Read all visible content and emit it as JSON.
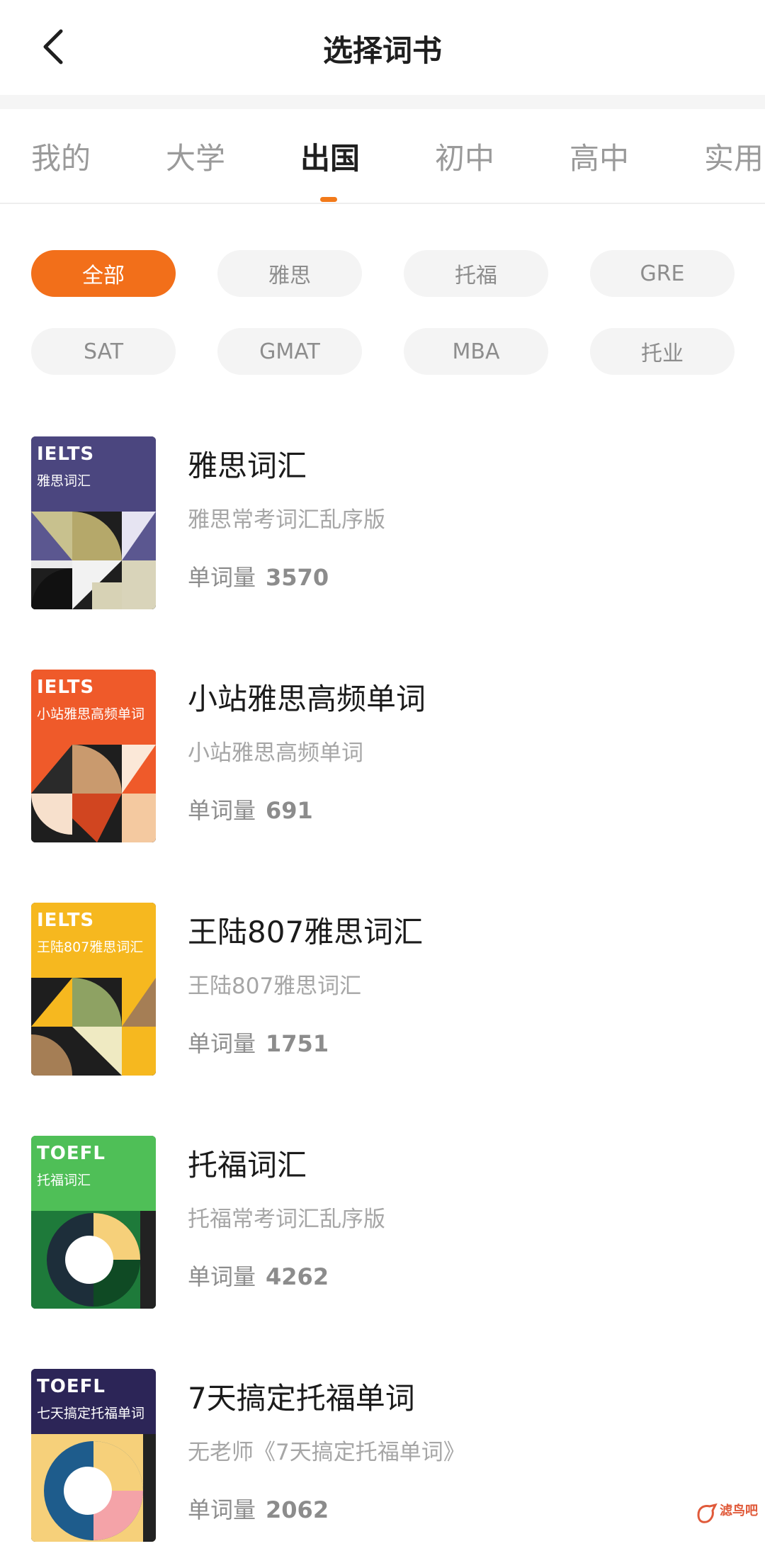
{
  "header": {
    "title": "选择词书"
  },
  "tabs": [
    {
      "label": "我的",
      "active": false
    },
    {
      "label": "大学",
      "active": false
    },
    {
      "label": "出国",
      "active": true
    },
    {
      "label": "初中",
      "active": false
    },
    {
      "label": "高中",
      "active": false
    },
    {
      "label": "实用",
      "active": false
    }
  ],
  "accent_color": "#f26f1a",
  "filters": [
    {
      "label": "全部",
      "active": true
    },
    {
      "label": "雅思",
      "active": false
    },
    {
      "label": "托福",
      "active": false
    },
    {
      "label": "GRE",
      "active": false
    },
    {
      "label": "SAT",
      "active": false
    },
    {
      "label": "GMAT",
      "active": false
    },
    {
      "label": "MBA",
      "active": false
    },
    {
      "label": "托业",
      "active": false
    }
  ],
  "count_label": "单词量",
  "books": [
    {
      "code": "IELTS",
      "cover_name": "雅思词汇",
      "title": "雅思词汇",
      "desc": "雅思常考词汇乱序版",
      "count": "3570",
      "cover_color": "#4b467f"
    },
    {
      "code": "IELTS",
      "cover_name": "小站雅思高频单词",
      "title": "小站雅思高频单词",
      "desc": "小站雅思高频单词",
      "count": "691",
      "cover_color": "#ef5a2a"
    },
    {
      "code": "IELTS",
      "cover_name": "王陆807雅思词汇",
      "title": "王陆807雅思词汇",
      "desc": "王陆807雅思词汇",
      "count": "1751",
      "cover_color": "#f6b81f"
    },
    {
      "code": "TOEFL",
      "cover_name": "托福词汇",
      "title": "托福词汇",
      "desc": "托福常考词汇乱序版",
      "count": "4262",
      "cover_color": "#4fbf57"
    },
    {
      "code": "TOEFL",
      "cover_name": "七天搞定托福单词",
      "title": "7天搞定托福单词",
      "desc": "无老师《7天搞定托福单词》",
      "count": "2062",
      "cover_color": "#2c2557"
    }
  ],
  "watermark": {
    "text": "滤鸟吧",
    "icon": "watermark-logo-icon"
  }
}
